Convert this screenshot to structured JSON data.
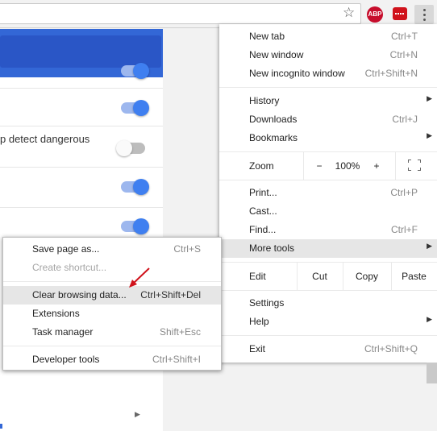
{
  "toolbar": {
    "star_icon": "bookmark-star-icon",
    "abp_label": "ABP",
    "menu_icon": "three-dots-vertical-icon"
  },
  "page": {
    "setting_text": "p detect dangerous",
    "toggles": [
      true,
      true,
      false,
      true,
      true
    ]
  },
  "menu": {
    "new_tab": {
      "label": "New tab",
      "shortcut": "Ctrl+T"
    },
    "new_window": {
      "label": "New window",
      "shortcut": "Ctrl+N"
    },
    "new_incognito": {
      "label": "New incognito window",
      "shortcut": "Ctrl+Shift+N"
    },
    "history": {
      "label": "History"
    },
    "downloads": {
      "label": "Downloads",
      "shortcut": "Ctrl+J"
    },
    "bookmarks": {
      "label": "Bookmarks"
    },
    "zoom": {
      "label": "Zoom",
      "minus": "−",
      "value": "100%",
      "plus": "+"
    },
    "print": {
      "label": "Print...",
      "shortcut": "Ctrl+P"
    },
    "cast": {
      "label": "Cast..."
    },
    "find": {
      "label": "Find...",
      "shortcut": "Ctrl+F"
    },
    "more_tools": {
      "label": "More tools"
    },
    "edit": {
      "label": "Edit",
      "cut": "Cut",
      "copy": "Copy",
      "paste": "Paste"
    },
    "settings": {
      "label": "Settings"
    },
    "help": {
      "label": "Help"
    },
    "exit": {
      "label": "Exit",
      "shortcut": "Ctrl+Shift+Q"
    }
  },
  "submenu": {
    "save_page": {
      "label": "Save page as...",
      "shortcut": "Ctrl+S"
    },
    "create_shortcut": {
      "label": "Create shortcut..."
    },
    "clear_browsing": {
      "label": "Clear browsing data...",
      "shortcut": "Ctrl+Shift+Del"
    },
    "extensions": {
      "label": "Extensions"
    },
    "task_manager": {
      "label": "Task manager",
      "shortcut": "Shift+Esc"
    },
    "developer_tools": {
      "label": "Developer tools",
      "shortcut": "Ctrl+Shift+I"
    }
  },
  "colors": {
    "header_blue": "#3367d6",
    "toggle_on": "#3f7ff0",
    "highlight": "#e6e6e6",
    "annotation_arrow": "#d0121b"
  }
}
